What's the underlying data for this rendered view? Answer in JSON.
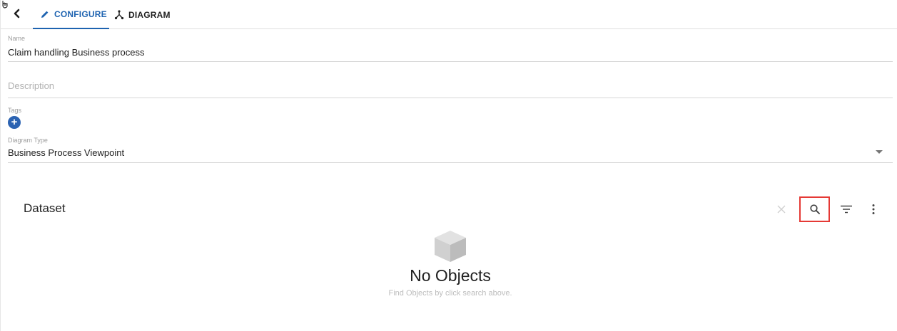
{
  "tabs": [
    {
      "label": "CONFIGURE",
      "icon": "pencil-icon",
      "active": true
    },
    {
      "label": "DIAGRAM",
      "icon": "diagram-icon",
      "active": false
    }
  ],
  "form": {
    "name": {
      "label": "Name",
      "value": "Claim handling Business process"
    },
    "description": {
      "placeholder": "Description"
    },
    "tags": {
      "label": "Tags",
      "add": "+"
    },
    "diagram_type": {
      "label": "Diagram Type",
      "value": "Business Process Viewpoint"
    }
  },
  "dataset": {
    "title": "Dataset",
    "actions": [
      "clear-icon",
      "search-icon",
      "filter-icon",
      "more-vert-icon"
    ],
    "empty_title": "No Objects",
    "empty_hint": "Find Objects by click search above."
  },
  "colors": {
    "accent": "#1e63b0",
    "highlight": "#e53935",
    "tag_button": "#2c63b2"
  }
}
